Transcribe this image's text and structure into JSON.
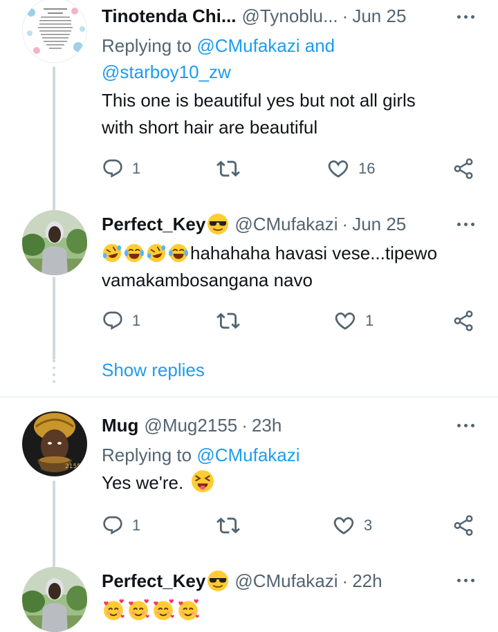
{
  "tweets": [
    {
      "name": "Tinotenda Chi...",
      "handle": "@Tynoblu...",
      "time": "Jun 25",
      "replying_prefix": "Replying to",
      "mentions_line1": "@CMufakazi and",
      "mentions_line2": "@starboy10_zw",
      "text_line1": "This one is beautiful yes but not all girls",
      "text_line2": "with short hair are beautiful",
      "replies": "1",
      "likes": "16"
    },
    {
      "name": "Perfect_Key",
      "handle": "@CMufakazi",
      "time": "Jun 25",
      "text_line1": "hahahaha havasi vese...tipewo",
      "text_line2": "vamakambosangana navo",
      "replies": "1",
      "likes": "1"
    },
    {
      "name": "Mug",
      "handle": "@Mug2155",
      "time": "23h",
      "replying_prefix": "Replying to",
      "mentions_line1": "@CMufakazi",
      "text_line1": "Yes we're.",
      "replies": "1",
      "likes": "3"
    },
    {
      "name": "Perfect_Key",
      "handle": "@CMufakazi",
      "time": "22h"
    }
  ],
  "show_replies": "Show replies",
  "separator": "·",
  "icons": [
    "reply-icon",
    "retweet-icon",
    "like-icon",
    "share-icon",
    "more-icon"
  ],
  "colors": {
    "link": "#1d9bf0",
    "secondary": "#536471",
    "primary": "#0f1419",
    "line": "#cfd9de"
  }
}
